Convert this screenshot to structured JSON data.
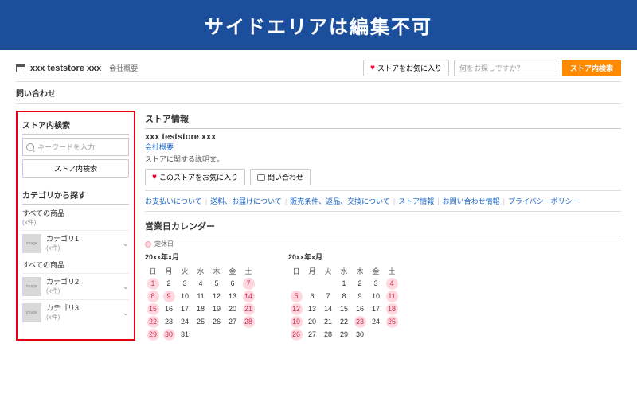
{
  "banner": "サイドエリアは編集不可",
  "top": {
    "store_name": "xxx teststore xxx",
    "store_sub": "会社概要",
    "fav_label": "ストアをお気に入り",
    "search_placeholder": "何をお探しですか？",
    "search_btn": "ストア内検索"
  },
  "inquiry_label": "問い合わせ",
  "sidebar": {
    "search_head": "ストア内検索",
    "search_placeholder": "キーワードを入力",
    "search_btn": "ストア内検索",
    "cat_head": "カテゴリから探す",
    "all_label": "すべての商品",
    "all_count": "(x件)",
    "items": [
      {
        "label": "カテゴリ1",
        "count": "(x件)"
      },
      {
        "label": "カテゴリ2",
        "count": "(x件)"
      },
      {
        "label": "カテゴリ3",
        "count": "(x件)"
      }
    ],
    "all_again": "すべての商品"
  },
  "main": {
    "info_head": "ストア情報",
    "store_name": "xxx teststore xxx",
    "overview_link": "会社概要",
    "desc": "ストアに関する説明文。",
    "fav_btn": "このストアをお気に入り",
    "inquiry_btn": "問い合わせ",
    "links": [
      "お支払いについて",
      "送料、お届けについて",
      "販売条件、返品、交換について",
      "ストア情報",
      "お問い合わせ情報",
      "プライバシーポリシー"
    ],
    "cal_head": "営業日カレンダー",
    "holiday_label": "定休日",
    "cal1": {
      "month": "20xx年x月",
      "dow": [
        "日",
        "月",
        "火",
        "水",
        "木",
        "金",
        "土"
      ],
      "weeks": [
        [
          {
            "d": 1,
            "h": true
          },
          {
            "d": 2
          },
          {
            "d": 3
          },
          {
            "d": 4
          },
          {
            "d": 5
          },
          {
            "d": 6
          },
          {
            "d": 7,
            "h": true
          }
        ],
        [
          {
            "d": 8,
            "h": true
          },
          {
            "d": 9,
            "h": true
          },
          {
            "d": 10
          },
          {
            "d": 11
          },
          {
            "d": 12
          },
          {
            "d": 13
          },
          {
            "d": 14,
            "h": true
          }
        ],
        [
          {
            "d": 15,
            "h": true
          },
          {
            "d": 16
          },
          {
            "d": 17
          },
          {
            "d": 18
          },
          {
            "d": 19
          },
          {
            "d": 20
          },
          {
            "d": 21,
            "h": true
          }
        ],
        [
          {
            "d": 22,
            "h": true
          },
          {
            "d": 23
          },
          {
            "d": 24
          },
          {
            "d": 25
          },
          {
            "d": 26
          },
          {
            "d": 27
          },
          {
            "d": 28,
            "h": true
          }
        ],
        [
          {
            "d": 29,
            "h": true
          },
          {
            "d": 30,
            "h": true
          },
          {
            "d": 31
          },
          {
            "d": ""
          },
          {
            "d": ""
          },
          {
            "d": ""
          },
          {
            "d": ""
          }
        ]
      ]
    },
    "cal2": {
      "month": "20xx年x月",
      "dow": [
        "日",
        "月",
        "火",
        "水",
        "木",
        "金",
        "土"
      ],
      "weeks": [
        [
          {
            "d": ""
          },
          {
            "d": ""
          },
          {
            "d": ""
          },
          {
            "d": 1
          },
          {
            "d": 2
          },
          {
            "d": 3
          },
          {
            "d": 4,
            "h": true
          }
        ],
        [
          {
            "d": 5,
            "h": true
          },
          {
            "d": 6
          },
          {
            "d": 7
          },
          {
            "d": 8
          },
          {
            "d": 9
          },
          {
            "d": 10
          },
          {
            "d": 11,
            "h": true
          }
        ],
        [
          {
            "d": 12,
            "h": true
          },
          {
            "d": 13
          },
          {
            "d": 14
          },
          {
            "d": 15
          },
          {
            "d": 16
          },
          {
            "d": 17
          },
          {
            "d": 18,
            "h": true
          }
        ],
        [
          {
            "d": 19,
            "h": true
          },
          {
            "d": 20
          },
          {
            "d": 21
          },
          {
            "d": 22
          },
          {
            "d": 23,
            "h": true
          },
          {
            "d": 24
          },
          {
            "d": 25,
            "h": true
          }
        ],
        [
          {
            "d": 26,
            "h": true
          },
          {
            "d": 27
          },
          {
            "d": 28
          },
          {
            "d": 29
          },
          {
            "d": 30
          },
          {
            "d": ""
          },
          {
            "d": ""
          }
        ]
      ]
    }
  }
}
